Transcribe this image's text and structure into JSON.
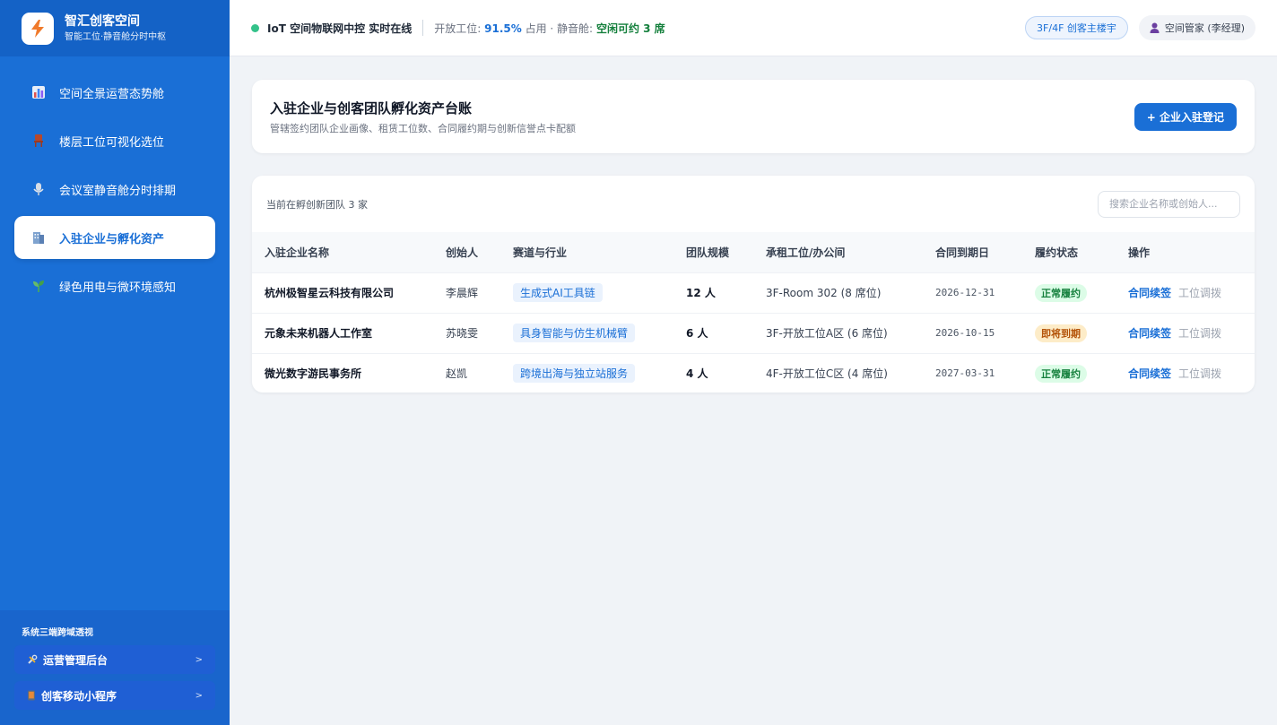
{
  "brand": {
    "title": "智汇创客空间",
    "subtitle": "智能工位·静音舱分时中枢"
  },
  "sidebar": {
    "items": [
      {
        "label": "空间全景运营态势舱",
        "icon": "bar-chart-icon",
        "active": false
      },
      {
        "label": "楼层工位可视化选位",
        "icon": "chair-icon",
        "active": false
      },
      {
        "label": "会议室静音舱分时排期",
        "icon": "microphone-icon",
        "active": false
      },
      {
        "label": "入驻企业与孵化资产",
        "icon": "office-building-icon",
        "active": true
      },
      {
        "label": "绿色用电与微环境感知",
        "icon": "seedling-icon",
        "active": false
      }
    ],
    "bottom_title": "系统三端跨域透视",
    "links": [
      {
        "label": "运营管理后台",
        "icon": "tools-icon",
        "chevron": ">"
      },
      {
        "label": "创客移动小程序",
        "icon": "mobile-icon",
        "chevron": ">"
      }
    ]
  },
  "topbar": {
    "status": "IoT 空间物联网中控 实时在线",
    "stat_prefix": "开放工位:",
    "stat_value": "91.5%",
    "stat_mid": "占用 · 静音舱:",
    "stat_avail": "空闲可约 3 席",
    "building": "3F/4F 创客主楼宇",
    "user": "空间管家 (李经理)"
  },
  "page": {
    "title": "入驻企业与创客团队孵化资产台账",
    "subtitle": "管辖签约团队企业画像、租赁工位数、合同履约期与创新信誉点卡配额",
    "add_button": "+ 企业入驻登记"
  },
  "table": {
    "count_text": "当前在孵创新团队 3 家",
    "search_placeholder": "搜索企业名称或创始人...",
    "headers": {
      "name": "入驻企业名称",
      "founder": "创始人",
      "track": "赛道与行业",
      "team": "团队规模",
      "space": "承租工位/办公间",
      "date": "合同到期日",
      "status": "履约状态",
      "ops": "操作"
    },
    "rows": [
      {
        "name": "杭州极智星云科技有限公司",
        "founder": "李晨辉",
        "track": "生成式AI工具链",
        "team": "12 人",
        "space": "3F-Room 302 (8 席位)",
        "date": "2026-12-31",
        "status": "正常履约",
        "status_type": "ok",
        "op1": "合同续签",
        "op2": "工位调拨"
      },
      {
        "name": "元象未来机器人工作室",
        "founder": "苏晓雯",
        "track": "具身智能与仿生机械臂",
        "team": "6 人",
        "space": "3F-开放工位A区 (6 席位)",
        "date": "2026-10-15",
        "status": "即将到期",
        "status_type": "warn",
        "op1": "合同续签",
        "op2": "工位调拨"
      },
      {
        "name": "微光数字游民事务所",
        "founder": "赵凯",
        "track": "跨境出海与独立站服务",
        "team": "4 人",
        "space": "4F-开放工位C区 (4 席位)",
        "date": "2027-03-31",
        "status": "正常履约",
        "status_type": "ok",
        "op1": "合同续签",
        "op2": "工位调拨"
      }
    ]
  },
  "colors": {
    "primary": "#1a6fd6",
    "sidebar": "#1a6fd6",
    "success": "#15803d",
    "warning": "#b45309"
  }
}
